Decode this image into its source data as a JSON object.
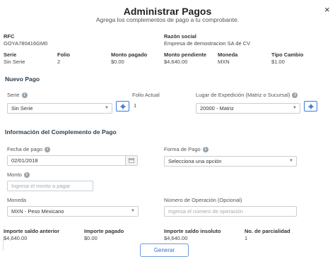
{
  "modal": {
    "title": "Administrar Pagos",
    "subtitle": "Agrega los complementos de pago a tu comprobante.",
    "close_icon": "×"
  },
  "emisor": {
    "rfc_label": "RFC",
    "rfc_value": "GOYA780416GM0",
    "razon_label": "Razón social",
    "razon_value": "Empresa de demostracion SA de CV"
  },
  "doc": {
    "serie_label": "Serie",
    "serie_value": "Sin Serie",
    "folio_label": "Folio",
    "folio_value": "2",
    "monto_pagado_label": "Monto pagado",
    "monto_pagado_value": "$0.00",
    "monto_pendiente_label": "Monto pendiente",
    "monto_pendiente_value": "$4,640.00",
    "moneda_label": "Moneda",
    "moneda_value": "MXN",
    "tipo_cambio_label": "Tipo Cambio",
    "tipo_cambio_value": "$1.00"
  },
  "nuevo_pago": {
    "section_title": "Nuevo Pago",
    "serie_label": "Serie",
    "serie_select": "Sin Serie",
    "folio_actual_label": "Folio Actual",
    "folio_actual_value": "1",
    "lugar_label": "Lugar de Expedición (Matriz o Sucursal)",
    "lugar_select": "20000 - Matriz"
  },
  "complemento": {
    "section_title": "Información del Complemento de Pago",
    "fecha_label": "Fecha de pago",
    "fecha_value": "02/01/2018",
    "forma_label": "Forma de Pago",
    "forma_select": "Selecciona una opción",
    "monto_label": "Monto",
    "monto_placeholder": "Ingresa el monto a pagar",
    "moneda_label": "Moneda",
    "moneda_select": "MXN - Peso Mexicano",
    "num_op_label": "Número de Operación (Opcional)",
    "num_op_placeholder": "Ingresa el número de operación"
  },
  "resumen": {
    "saldo_anterior_label": "Importe saldo anterior",
    "saldo_anterior_value": "$4,640.00",
    "importe_pagado_label": "Importe pagado",
    "importe_pagado_value": "$0.00",
    "saldo_insoluto_label": "Importe saldo insoluto",
    "saldo_insoluto_value": "$4,640.00",
    "parcialidad_label": "No. de parcialidad",
    "parcialidad_value": "1"
  },
  "actions": {
    "generar_label": "Generar"
  },
  "colors": {
    "accent": "#3a7bd5",
    "section": "#2c3e50"
  },
  "icons": {
    "settings": "gear-icon",
    "info": "info-icon",
    "calendar": "calendar-icon",
    "close": "close-icon"
  }
}
